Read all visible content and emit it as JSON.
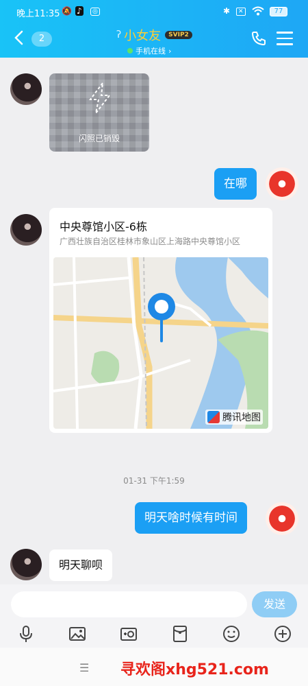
{
  "status_bar": {
    "time": "晚上11:35",
    "battery": "77"
  },
  "header": {
    "unread_count": "2",
    "contact_name": "小女友",
    "svip": "SVIP2",
    "online_status": "手机在线",
    "accent_color": "#1ea7f5"
  },
  "messages": {
    "flash_photo": {
      "label": "闪照已销毁"
    },
    "out_where": "在哪",
    "location": {
      "name": "中央尊馆小区-6栋",
      "address": "广西壮族自治区桂林市象山区上海路中央尊馆小区",
      "brand": "腾讯地图"
    },
    "timestamp": "01-31 下午1:59",
    "out_ask": "明天啥时候有时间",
    "in_reply": "明天聊呗"
  },
  "input_bar": {
    "placeholder": "",
    "send_label": "发送"
  },
  "toolbar_icons": [
    "microphone-icon",
    "image-icon",
    "camera-icon",
    "red-packet-icon",
    "emoji-icon",
    "plus-icon"
  ],
  "watermark": "寻欢阁xhg521.com"
}
